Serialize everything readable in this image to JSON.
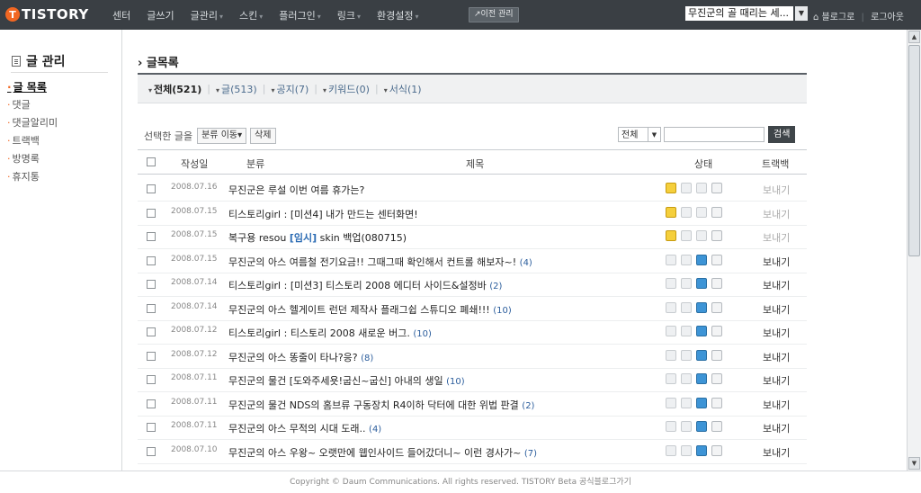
{
  "header": {
    "logo": "TISTORY",
    "menu": [
      {
        "label": "센터",
        "arrow": ""
      },
      {
        "label": "글쓰기",
        "arrow": ""
      },
      {
        "label": "글관리",
        "arrow": "▾"
      },
      {
        "label": "스킨",
        "arrow": "▾"
      },
      {
        "label": "플러그인",
        "arrow": "▾"
      },
      {
        "label": "링크",
        "arrow": "▾"
      },
      {
        "label": "환경설정",
        "arrow": "▾"
      }
    ],
    "prev_admin": "↗이전 관리",
    "blog_select": "무진군의 골 때리는 세...",
    "blog_link": "블로그로",
    "logout": "로그아웃"
  },
  "sidebar": {
    "title": "글 관리",
    "items": [
      "글 목록",
      "댓글",
      "댓글알리미",
      "트랙백",
      "방명록",
      "휴지통"
    ]
  },
  "main": {
    "title": "글목록",
    "filters": [
      {
        "label": "전체(521)",
        "active": true
      },
      {
        "label": "글(513)",
        "active": false
      },
      {
        "label": "공지(7)",
        "active": false
      },
      {
        "label": "키워드(0)",
        "active": false
      },
      {
        "label": "서식(1)",
        "active": false
      }
    ],
    "toolbar": {
      "selected_label": "선택한 글을",
      "move_label": "분류 이동▾",
      "delete_label": "삭제",
      "scope_value": "전체",
      "search_value": "",
      "search_label": "검색"
    },
    "columns": {
      "date": "작성일",
      "category": "분류",
      "title": "제목",
      "status": "상태",
      "trackback": "트랙백"
    },
    "rows": [
      {
        "date": "2008.07.16",
        "cat": "무진군은 루설",
        "temp": "",
        "title": "이번 여름 휴가는?",
        "count": "",
        "locked": true,
        "tb": "보내기",
        "tb_enabled": false
      },
      {
        "date": "2008.07.15",
        "cat": "티스토리girl :",
        "temp": "",
        "title": "[미션4] 내가 만드는 센터화면!",
        "count": "",
        "locked": true,
        "tb": "보내기",
        "tb_enabled": false
      },
      {
        "date": "2008.07.15",
        "cat": "복구용 resou",
        "temp": "[임시]",
        "title": "skin 백업(080715)",
        "count": "",
        "locked": true,
        "tb": "보내기",
        "tb_enabled": false
      },
      {
        "date": "2008.07.15",
        "cat": "무진군의 아스",
        "temp": "",
        "title": "여름철 전기요금!! 그때그때 확인해서 컨트롤 해보자~!",
        "count": "(4)",
        "locked": false,
        "tb": "보내기",
        "tb_enabled": true
      },
      {
        "date": "2008.07.14",
        "cat": "티스토리girl :",
        "temp": "",
        "title": "[미션3] 티스토리 2008 에디터 사이드&설정바",
        "count": "(2)",
        "locked": false,
        "tb": "보내기",
        "tb_enabled": true
      },
      {
        "date": "2008.07.14",
        "cat": "무진군의 아스",
        "temp": "",
        "title": "헬게이트 런던 제작사 플래그쉽 스튜디오 폐쇄!!!",
        "count": "(10)",
        "locked": false,
        "tb": "보내기",
        "tb_enabled": true
      },
      {
        "date": "2008.07.12",
        "cat": "티스토리girl :",
        "temp": "",
        "title": "티스토리 2008 새로운 버그.",
        "count": "(10)",
        "locked": false,
        "tb": "보내기",
        "tb_enabled": true
      },
      {
        "date": "2008.07.12",
        "cat": "무진군의 아스",
        "temp": "",
        "title": "똥줄이 타나?응?",
        "count": "(8)",
        "locked": false,
        "tb": "보내기",
        "tb_enabled": true
      },
      {
        "date": "2008.07.11",
        "cat": "무진군의 물건",
        "temp": "",
        "title": "[도와주세욧!굽신~굽신] 아내의 생일",
        "count": "(10)",
        "locked": false,
        "tb": "보내기",
        "tb_enabled": true
      },
      {
        "date": "2008.07.11",
        "cat": "무진군의 물건",
        "temp": "",
        "title": "NDS의 홈브류 구동장치 R4이하 닥터에 대한 위법 판결",
        "count": "(2)",
        "locked": false,
        "tb": "보내기",
        "tb_enabled": true
      },
      {
        "date": "2008.07.11",
        "cat": "무진군의 아스",
        "temp": "",
        "title": "무적의 시대 도래..",
        "count": "(4)",
        "locked": false,
        "tb": "보내기",
        "tb_enabled": true
      },
      {
        "date": "2008.07.10",
        "cat": "무진군의 아스",
        "temp": "",
        "title": "우왕~ 오랫만에 웹인사이드 들어갔더니~ 이런 경사가~",
        "count": "(7)",
        "locked": false,
        "tb": "보내기",
        "tb_enabled": true
      }
    ]
  },
  "footer": {
    "text": "Copyright © Daum Communications. All rights reserved. TISTORY Beta 공식블로그가기"
  },
  "colors": {
    "accent": "#f26722",
    "topbar": "#3a3f44",
    "link": "#2b5d9c"
  }
}
